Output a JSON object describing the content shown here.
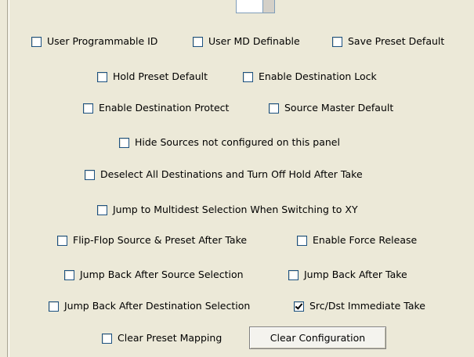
{
  "options": {
    "user_programmable_id": {
      "label": "User Programmable ID",
      "checked": false
    },
    "user_md_definable": {
      "label": "User MD Definable",
      "checked": false
    },
    "save_preset_default": {
      "label": "Save Preset Default",
      "checked": false
    },
    "hold_preset_default": {
      "label": "Hold Preset Default",
      "checked": false
    },
    "enable_destination_lock": {
      "label": "Enable Destination Lock",
      "checked": false
    },
    "enable_destination_protect": {
      "label": "Enable Destination Protect",
      "checked": false
    },
    "source_master_default": {
      "label": "Source Master Default",
      "checked": false
    },
    "hide_sources": {
      "label": "Hide Sources not configured on this panel",
      "checked": false
    },
    "deselect_all_destinations": {
      "label": "Deselect All Destinations and Turn Off Hold After Take",
      "checked": false
    },
    "jump_to_multidest": {
      "label": "Jump to Multidest Selection When Switching to XY",
      "checked": false
    },
    "flip_flop_source": {
      "label": "Flip-Flop Source & Preset After Take",
      "checked": false
    },
    "enable_force_release": {
      "label": "Enable Force Release",
      "checked": false
    },
    "jump_back_after_source": {
      "label": "Jump Back After Source Selection",
      "checked": false
    },
    "jump_back_after_take": {
      "label": "Jump Back After Take",
      "checked": false
    },
    "jump_back_after_destination": {
      "label": "Jump Back After Destination Selection",
      "checked": false
    },
    "src_dst_immediate_take": {
      "label": "Src/Dst Immediate Take",
      "checked": true
    },
    "clear_preset_mapping": {
      "label": "Clear Preset Mapping",
      "checked": false
    }
  },
  "buttons": {
    "clear_configuration": "Clear Configuration"
  }
}
